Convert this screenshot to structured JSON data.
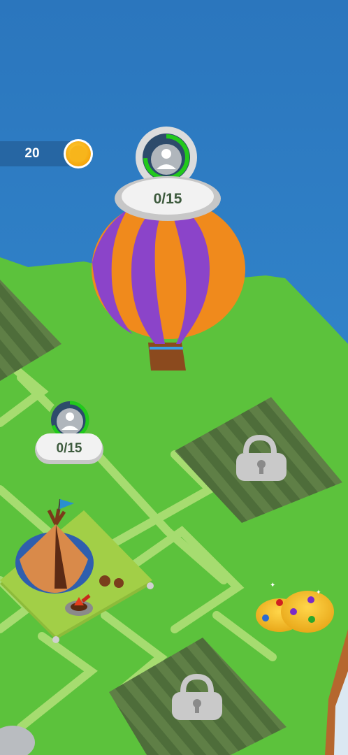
{
  "hud": {
    "coin_count": "20",
    "coin_icon": "gold-coin-icon"
  },
  "balloon_station": {
    "counter": "0/15",
    "icon": "person-icon",
    "balloon_colors": [
      "#f08a1c",
      "#8b44c9"
    ]
  },
  "tent_station": {
    "counter": "0/15",
    "icon": "person-icon"
  },
  "locked_plots": [
    {
      "icon": "padlock-icon"
    },
    {
      "icon": "padlock-icon"
    },
    {
      "icon": "padlock-icon"
    }
  ],
  "colors": {
    "ocean": "#2f7fc4",
    "grass": "#5cc23c",
    "path": "#a6dc70",
    "progress_ring": "#21c41b",
    "locked_plot": "#4c6b38"
  }
}
